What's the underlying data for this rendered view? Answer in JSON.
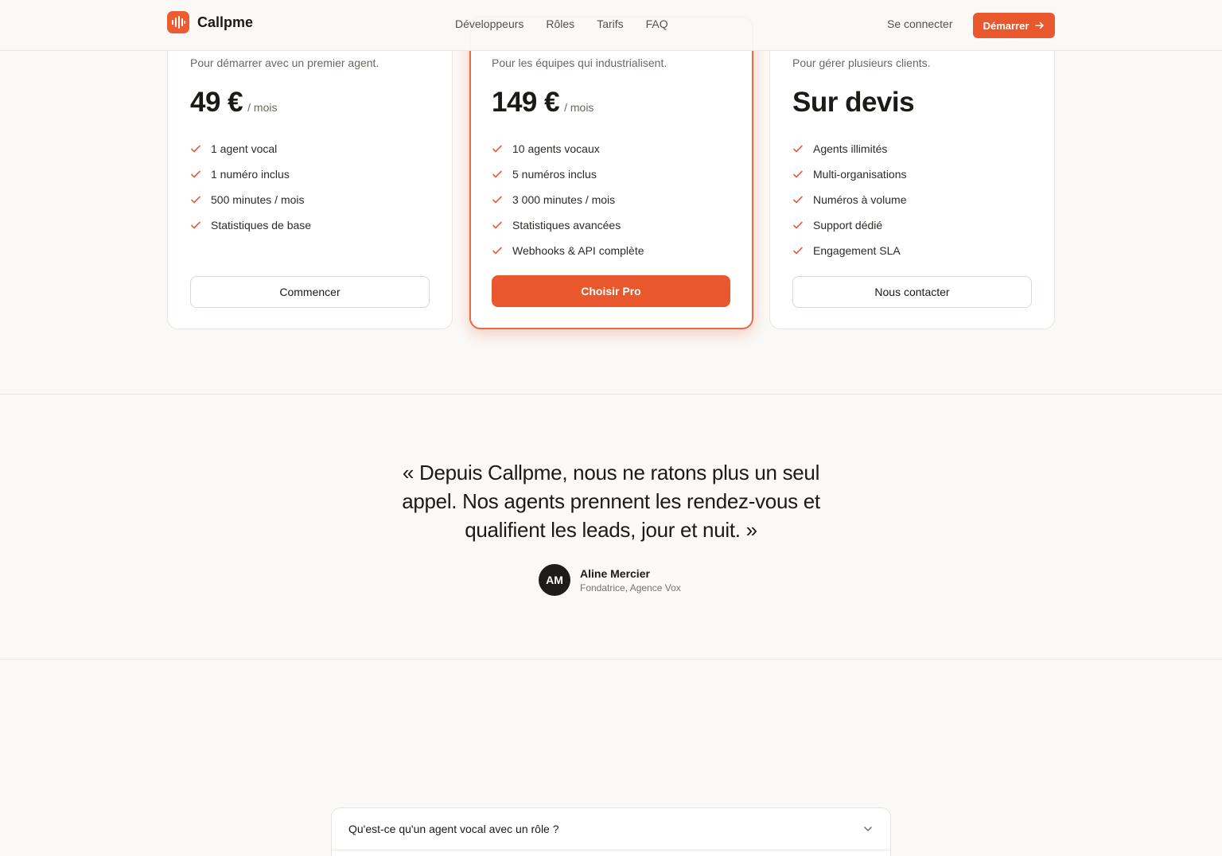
{
  "header": {
    "brand": "Callpme",
    "nav": [
      "Développeurs",
      "Rôles",
      "Tarifs",
      "FAQ"
    ],
    "login_label": "Se connecter",
    "start_label": "Démarrer"
  },
  "plans": [
    {
      "tagline": "Pour démarrer avec un premier agent.",
      "price": "49 €",
      "period": "/ mois",
      "features": [
        "1 agent vocal",
        "1 numéro inclus",
        "500 minutes / mois",
        "Statistiques de base"
      ],
      "cta": "Commencer",
      "highlighted": false
    },
    {
      "tagline": "Pour les équipes qui industrialisent.",
      "price": "149 €",
      "period": "/ mois",
      "features": [
        "10 agents vocaux",
        "5 numéros inclus",
        "3 000 minutes / mois",
        "Statistiques avancées",
        "Webhooks & API complète"
      ],
      "cta": "Choisir Pro",
      "highlighted": true
    },
    {
      "tagline": "Pour gérer plusieurs clients.",
      "price": "Sur devis",
      "period": "",
      "features": [
        "Agents illimités",
        "Multi-organisations",
        "Numéros à volume",
        "Support dédié",
        "Engagement SLA"
      ],
      "cta": "Nous contacter",
      "highlighted": false
    }
  ],
  "testimonial": {
    "quote": "« Depuis Callpme, nous ne ratons plus un seul appel. Nos agents prennent les rendez-vous et qualifient les leads, jour et nuit. »",
    "initials": "AM",
    "name": "Aline Mercier",
    "role": "Fondatrice, Agence Vox"
  },
  "faq": {
    "items": [
      {
        "question": "Qu'est-ce qu'un agent vocal avec un rôle ?"
      }
    ]
  },
  "colors": {
    "accent": "#e9572c",
    "check": "#e0603a",
    "text": "#1c1a17",
    "muted": "#6b6760",
    "background": "#faf9f7"
  },
  "icons": {
    "logo": "sound-wave-icon",
    "start_arrow": "arrow-right-icon",
    "feature": "check-icon",
    "faq_toggle": "chevron-down-icon"
  }
}
